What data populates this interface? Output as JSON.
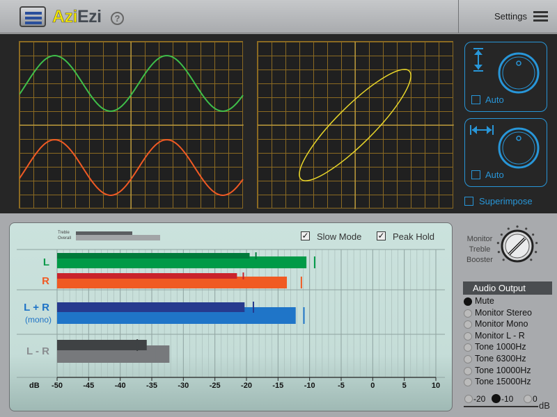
{
  "app": {
    "name_part1": "Azi",
    "name_part2": "Ezi",
    "help_symbol": "?"
  },
  "header": {
    "settings_label": "Settings"
  },
  "scope_controls": {
    "vertical": {
      "auto_label": "Auto",
      "auto_checked": false
    },
    "horizontal": {
      "auto_label": "Auto",
      "auto_checked": false
    },
    "superimpose_label": "Superimpose",
    "superimpose_checked": false
  },
  "meter": {
    "legend": {
      "treble": "Treble",
      "overall": "Overall"
    },
    "slow_mode": {
      "label": "Slow Mode",
      "checked": true
    },
    "peak_hold": {
      "label": "Peak Hold",
      "checked": true
    },
    "channels": {
      "l": {
        "label": "L",
        "color": "#0b9a4a"
      },
      "r": {
        "label": "R",
        "color": "#f05a24"
      },
      "lr_sum": {
        "label": "L + R",
        "sublabel": "(mono)",
        "color": "#1d72c6"
      },
      "lr_diff": {
        "label": "L - R",
        "color": "#8a8d90"
      }
    },
    "axis_unit": "dB",
    "ticks": [
      "-50",
      "-45",
      "-40",
      "-35",
      "-30",
      "-25",
      "-20",
      "-15",
      "-10",
      "-5",
      "0",
      "5",
      "10"
    ],
    "scale_min": -50,
    "scale_max": 10,
    "levels": {
      "l": {
        "treble": -19.5,
        "treble_peak": -18.5,
        "overall": -10.5,
        "overall_peak": -9.2,
        "treble_color": "#007a3a",
        "overall_color": "#009a47"
      },
      "r": {
        "treble": -21.5,
        "treble_peak": -20.5,
        "overall": -13.6,
        "overall_peak": -11.3,
        "treble_color": "#c9232b",
        "overall_color": "#f05a22"
      },
      "lr": {
        "treble": -20.3,
        "treble_peak": -18.9,
        "overall": -12.2,
        "overall_peak": -10.9,
        "treble_color": "#263a8e",
        "overall_color": "#1f75c8"
      },
      "diff": {
        "treble": -35.8,
        "treble_peak": -37.3,
        "overall": -32.2,
        "overall_peak": -34.3,
        "treble_color": "#3f4244",
        "overall_color": "#77797c"
      }
    }
  },
  "monitor": {
    "label_lines": [
      "Monitor",
      "Treble",
      "Booster"
    ]
  },
  "audio_output": {
    "header": "Audio Output",
    "options": [
      "Mute",
      "Monitor Stereo",
      "Monitor Mono",
      "Monitor L - R",
      "Tone 1000Hz",
      "Tone 6300Hz",
      "Tone 10000Hz",
      "Tone 15000Hz"
    ],
    "selected": "Mute"
  },
  "level_select": {
    "options": [
      "-20",
      "-10",
      "0"
    ],
    "selected": "-10",
    "unit": "dB"
  }
}
